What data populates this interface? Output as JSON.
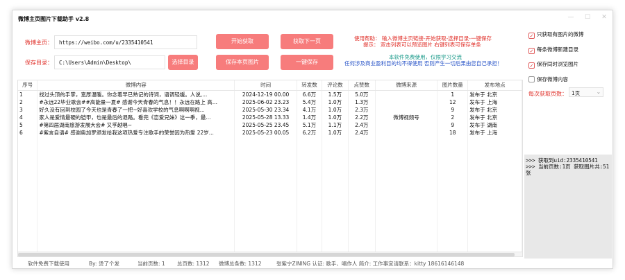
{
  "app": {
    "title": "微博主页图片下载助手 v2.8",
    "minimize": "—",
    "maximize": "☐",
    "close": "✕"
  },
  "form": {
    "homepage_label": "微博主页：",
    "homepage_value": "https://weibo.com/u/2335410541",
    "save_dir_label": "保存目录：",
    "save_dir_value": "C:\\Users\\Admin\\Desktop\\"
  },
  "buttons": {
    "start": "开始获取",
    "next_page": "获取下一页",
    "choose_dir": "选择目录",
    "save_page": "保存本页图片",
    "one_click": "一键保存"
  },
  "help": {
    "line1": "使用帮助：  输入微博主页链接-开始获取-选择目录-一键保存",
    "line2": "提示：  双击列表可以预览图片  右键列表可保存单条",
    "line3": "本软件免费使用，仅限学习交流",
    "line4": "任何涉及商业盈利目的均不得使用  否则产生一切后果由您自己承担！"
  },
  "table": {
    "columns": [
      "序号",
      "微博内容",
      "时间",
      "转发数",
      "评论数",
      "点赞数",
      "微博来源",
      "图片数量",
      "发布地点"
    ],
    "rows": [
      [
        "1",
        "找过头顶的手掌，宽厚温暖。你念着早已熟记的诗词，语调轻缓。人说,...",
        "2024-12-19 00.00",
        "6.6万",
        "1.5万",
        "5.0万",
        "",
        "1",
        "发布于 北京"
      ],
      [
        "2",
        "#永远22毕业歌会##高能量一夏# 感谢今天青春的气息！！永远在路上 高...",
        "2025-06-02 23.23",
        "5.4万",
        "1.0万",
        "1.3万",
        "",
        "12",
        "发布于 上海"
      ],
      [
        "3",
        "好久没有回到校园了今天也是青春了一把~好喜欢学校的气息啊啊啊视...",
        "2025-05-30 23.34",
        "4.1万",
        "1.0万",
        "2.3万",
        "",
        "9",
        "发布于 北京"
      ],
      [
        "4",
        "家人是爱情最硬的铠甲，也是最后的退路。看完《恋爱兄妹》这一季，最...",
        "2025-05-28 13.33",
        "1.4万",
        "1.0万",
        "2.2万",
        "微博视频号",
        "2",
        "发布于 北京"
      ],
      [
        "5",
        "#第四届湖南旅游发展大会# 又孚越唱~",
        "2025-05-25 23.45",
        "5.1万",
        "1.1万",
        "2.4万",
        "",
        "9",
        "发布于 湖南"
      ],
      [
        "6",
        "#紫言自语# 感谢奥加罗颁发给我这项热爱专注歌手的荣誉因为热爱 22岁...",
        "2025-05-23 00.05",
        "6.2万",
        "1.0万",
        "2.4万",
        "",
        "18",
        "发布于 上海"
      ]
    ]
  },
  "options": {
    "only_with_images": "只获取有图片的微博",
    "new_dir_each": "每条微博新建目录",
    "browse_images": "保存同时浏览图片",
    "save_content": "保存微博内容",
    "pages_label": "每次获取页数：",
    "pages_value": "1页"
  },
  "log": {
    "line1": ">>> 获取到uid:2335410541",
    "line2": ">>> 当前页数:1页 获取图片共:51张"
  },
  "status": {
    "free": "软件免费下载使用",
    "author": "By: 烫了个发",
    "current_page": "当前页数: 1",
    "total_pages": "总页数: 1312",
    "total_posts": "微博总条数: 1312",
    "user_info": "张紫宁ZINING  认证: 歌手、唱作人  简介: 工作事宜请联系：kitty 18616146148"
  }
}
